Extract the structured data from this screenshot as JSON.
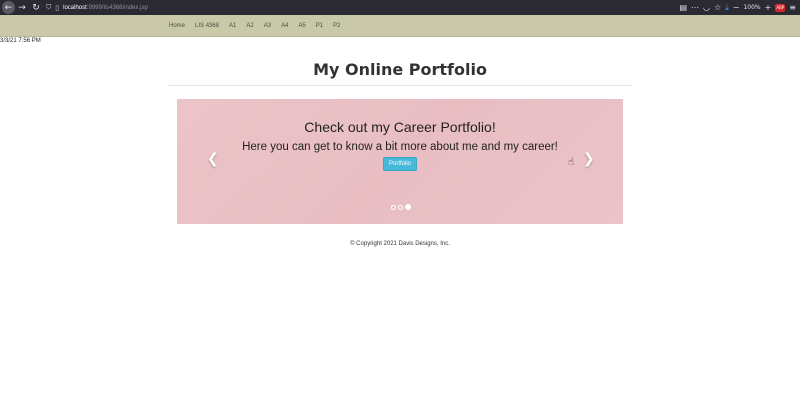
{
  "browser": {
    "back_icon": "arrow-left-icon",
    "forward_icon": "arrow-right-icon",
    "reload_icon": "reload-icon",
    "url_host": "localhost",
    "url_path": ":9999/lis4368/index.jsp",
    "zoom": "100%"
  },
  "nav": {
    "items": [
      "Home",
      "LIS 4368",
      "A1",
      "A2",
      "A3",
      "A4",
      "A5",
      "P1",
      "P2"
    ]
  },
  "timestamp": "3/3/21 7:56 PM",
  "page": {
    "title": "My Online Portfolio"
  },
  "carousel": {
    "heading": "Check out my Career Portfolio!",
    "subheading": "Here you can get to know a bit more about me and my career!",
    "button_label": "Portfolio",
    "prev_glyph": "❮",
    "next_glyph": "❯",
    "slide_count": 3,
    "active_slide": 3,
    "background": "#ebc3c8"
  },
  "footer": {
    "copyright": "© Copyright 2021 Davis Designs, Inc."
  },
  "colors": {
    "navbar": "#c9c8a8",
    "button": "#46b8da",
    "browser_chrome": "#2b2a33"
  }
}
